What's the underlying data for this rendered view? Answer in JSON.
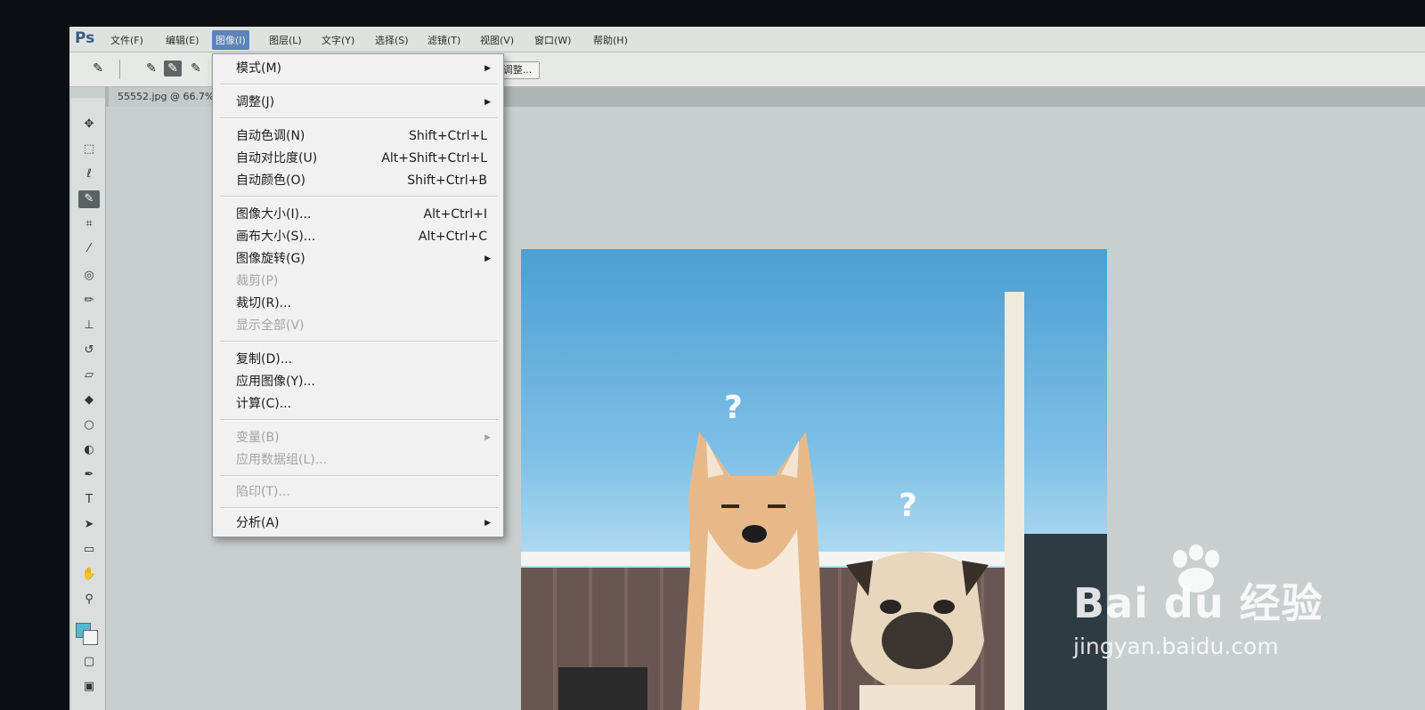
{
  "app": {
    "logo": "Ps"
  },
  "menubar": {
    "items": [
      "文件(F)",
      "编辑(E)",
      "图像(I)",
      "图层(L)",
      "文字(Y)",
      "选择(S)",
      "滤镜(T)",
      "视图(V)",
      "窗口(W)",
      "帮助(H)"
    ],
    "active_index": 2
  },
  "options_bar": {
    "refine_label": "调整..."
  },
  "document": {
    "tab_label": "55552.jpg @ 66.7%"
  },
  "canvas": {
    "qmark": "?"
  },
  "image_menu": {
    "items": [
      {
        "label": "模式(M)",
        "shortcut": "",
        "submenu": true,
        "enabled": true
      },
      {
        "label": "调整(J)",
        "shortcut": "",
        "submenu": true,
        "enabled": true
      },
      {
        "label": "自动色调(N)",
        "shortcut": "Shift+Ctrl+L",
        "submenu": false,
        "enabled": true
      },
      {
        "label": "自动对比度(U)",
        "shortcut": "Alt+Shift+Ctrl+L",
        "submenu": false,
        "enabled": true
      },
      {
        "label": "自动颜色(O)",
        "shortcut": "Shift+Ctrl+B",
        "submenu": false,
        "enabled": true
      },
      {
        "label": "图像大小(I)...",
        "shortcut": "Alt+Ctrl+I",
        "submenu": false,
        "enabled": true
      },
      {
        "label": "画布大小(S)...",
        "shortcut": "Alt+Ctrl+C",
        "submenu": false,
        "enabled": true
      },
      {
        "label": "图像旋转(G)",
        "shortcut": "",
        "submenu": true,
        "enabled": true
      },
      {
        "label": "裁剪(P)",
        "shortcut": "",
        "submenu": false,
        "enabled": false
      },
      {
        "label": "裁切(R)...",
        "shortcut": "",
        "submenu": false,
        "enabled": true
      },
      {
        "label": "显示全部(V)",
        "shortcut": "",
        "submenu": false,
        "enabled": false
      },
      {
        "label": "复制(D)...",
        "shortcut": "",
        "submenu": false,
        "enabled": true
      },
      {
        "label": "应用图像(Y)...",
        "shortcut": "",
        "submenu": false,
        "enabled": true
      },
      {
        "label": "计算(C)...",
        "shortcut": "",
        "submenu": false,
        "enabled": true
      },
      {
        "label": "变量(B)",
        "shortcut": "",
        "submenu": true,
        "enabled": false
      },
      {
        "label": "应用数据组(L)...",
        "shortcut": "",
        "submenu": false,
        "enabled": false
      },
      {
        "label": "陷印(T)...",
        "shortcut": "",
        "submenu": false,
        "enabled": false
      },
      {
        "label": "分析(A)",
        "shortcut": "",
        "submenu": true,
        "enabled": true
      }
    ]
  },
  "watermark": {
    "brand": "Bai du 经验",
    "url": "jingyan.baidu.com"
  },
  "colors": {
    "menu_highlight": "#5d84b8",
    "foreground_swatch": "#4fbad0",
    "background_swatch": "#f5f5f5"
  }
}
